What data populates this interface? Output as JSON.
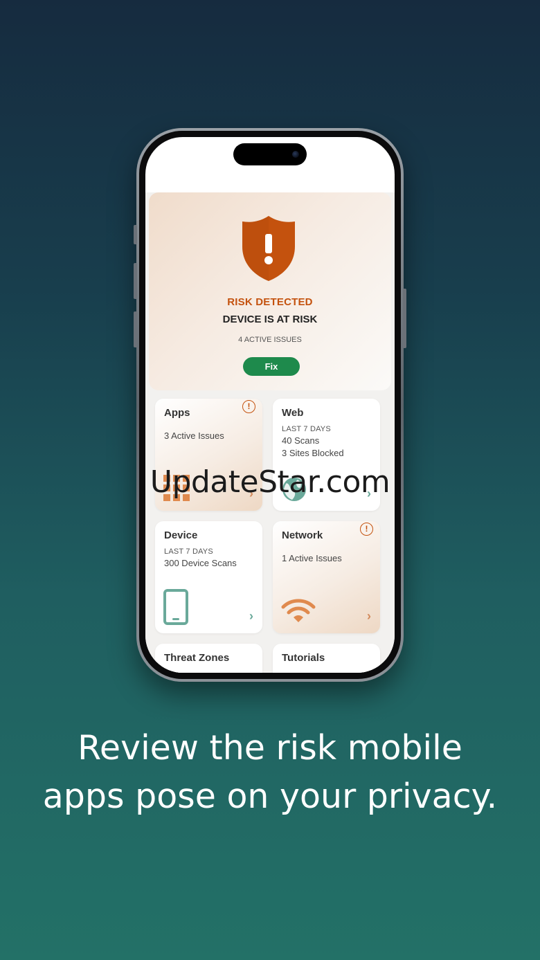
{
  "colors": {
    "risk_orange": "#c4520e",
    "fix_green": "#1e8a4c",
    "chevron_teal": "#6aa99a",
    "chevron_orange": "#d28a5c",
    "background_top": "#162b3f",
    "background_bottom": "#237167"
  },
  "risk_card": {
    "icon": "shield-exclamation-icon",
    "title": "RISK DETECTED",
    "subtitle": "DEVICE IS AT RISK",
    "issue_count": "4 ACTIVE ISSUES",
    "fix_label": "Fix"
  },
  "tiles": {
    "apps": {
      "title": "Apps",
      "line1": "3 Active Issues",
      "icon": "grid-apps-icon"
    },
    "web": {
      "title": "Web",
      "period": "LAST 7 DAYS",
      "line1": "40 Scans",
      "line2": "3 Sites Blocked",
      "icon": "globe-icon"
    },
    "device": {
      "title": "Device",
      "period": "LAST 7 DAYS",
      "line1": "300 Device Scans",
      "icon": "phone-icon"
    },
    "network": {
      "title": "Network",
      "line1": "1 Active Issues",
      "icon": "wifi-icon"
    },
    "threat_zones": {
      "title": "Threat Zones"
    },
    "tutorials": {
      "title": "Tutorials"
    }
  },
  "watermark": "UpdateStar.com",
  "caption": {
    "line1": "Review the risk mobile",
    "line2": "apps pose on your privacy."
  }
}
